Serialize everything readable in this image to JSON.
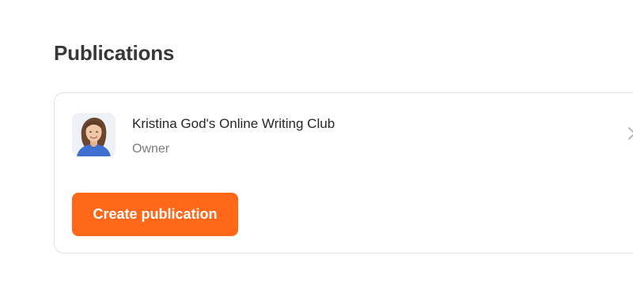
{
  "section": {
    "title": "Publications"
  },
  "publication": {
    "name": "Kristina God's Online Writing Club",
    "role": "Owner",
    "avatar_icon": "person-photo-avatar",
    "chevron_icon": "chevron-right-icon"
  },
  "actions": {
    "create_label": "Create publication"
  },
  "colors": {
    "accent": "#ff6719",
    "title_text": "#363737",
    "secondary_text": "#7b7b7b",
    "border": "#e2e2e2"
  }
}
